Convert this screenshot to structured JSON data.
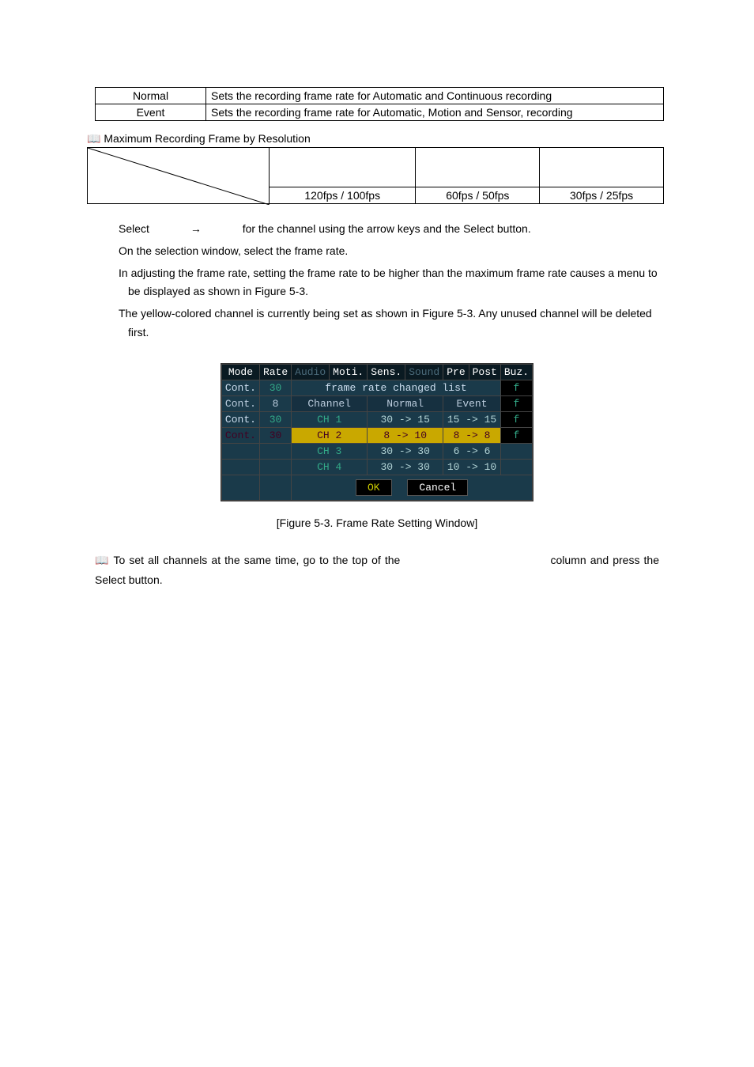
{
  "table1": {
    "rows": [
      {
        "label": "Normal",
        "desc": "Sets the recording frame rate for Automatic and Continuous recording"
      },
      {
        "label": "Event",
        "desc": "Sets the recording frame rate for Automatic, Motion and Sensor, recording"
      }
    ]
  },
  "section_title": "📖 Maximum Recording Frame by Resolution",
  "table2": {
    "cells": [
      "120fps / 100fps",
      "60fps / 50fps",
      "30fps / 25fps"
    ]
  },
  "body": {
    "p1a": "Select",
    "p1arrow": "→",
    "p1b": "for the channel using the arrow keys and the Select button.",
    "p2": "On the selection window, select the frame rate.",
    "p3": "In adjusting the frame rate, setting the frame rate to be higher than the maximum frame rate causes a menu to be displayed as shown in Figure 5-3.",
    "p4": "The yellow-colored channel is currently being set as shown in Figure 5-3. Any unused channel will be deleted first."
  },
  "figure": {
    "header": [
      "Mode",
      "Rate",
      "Audio",
      "Moti.",
      "Sens.",
      "Sound",
      "Pre",
      "Post",
      "Buz."
    ],
    "popup_title": "frame rate changed list",
    "subheader": [
      "Channel",
      "Normal",
      "Event"
    ],
    "left_rows": [
      {
        "mode": "Cont.",
        "rate": "30"
      },
      {
        "mode": "Cont.",
        "rate": "8"
      },
      {
        "mode": "Cont.",
        "rate": "30"
      },
      {
        "mode": "Cont.",
        "rate": "30"
      }
    ],
    "data_rows": [
      {
        "ch": "CH  1",
        "n": "30 -> 15",
        "e": "15 -> 15"
      },
      {
        "ch": "CH  2",
        "n": "8 -> 10",
        "e": "8 ->  8"
      },
      {
        "ch": "CH  3",
        "n": "30 -> 30",
        "e": "6 ->  6"
      },
      {
        "ch": "CH  4",
        "n": "30 -> 30",
        "e": "10 -> 10"
      }
    ],
    "side_f": "f",
    "ok": "OK",
    "cancel": "Cancel"
  },
  "caption": "[Figure 5-3. Frame Rate Setting Window]",
  "end": {
    "icon": "📖",
    "a": " To set all channels at the same time, go to the top of the ",
    "b": " column and press the Select button."
  }
}
